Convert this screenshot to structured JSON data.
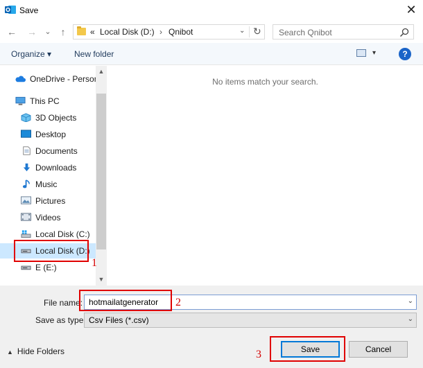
{
  "window": {
    "title": "Save",
    "app_icon": "outlook-app-icon",
    "close_glyph": "✕"
  },
  "navigation": {
    "back_glyph": "←",
    "forward_glyph": "→",
    "recent_glyph": "⌄",
    "up_glyph": "↑"
  },
  "address": {
    "overflow": "«",
    "segments": [
      "Local Disk (D:)",
      "Qnibot"
    ],
    "separator": "›",
    "dropdown_glyph": "⌄",
    "refresh_glyph": "↻"
  },
  "search": {
    "placeholder": "Search Qnibot",
    "icon": "search-icon"
  },
  "toolbar": {
    "organize_label": "Organize",
    "organize_dd": "▾",
    "new_folder_label": "New folder",
    "view_dd": "▾",
    "help_label": "?"
  },
  "sidebar": {
    "items": [
      {
        "label": "OneDrive - Person",
        "icon": "onedrive-cloud-icon"
      },
      {
        "label": "This PC",
        "icon": "computer-icon"
      },
      {
        "label": "3D Objects",
        "icon": "3d-objects-icon"
      },
      {
        "label": "Desktop",
        "icon": "desktop-icon"
      },
      {
        "label": "Documents",
        "icon": "documents-icon"
      },
      {
        "label": "Downloads",
        "icon": "downloads-icon"
      },
      {
        "label": "Music",
        "icon": "music-icon"
      },
      {
        "label": "Pictures",
        "icon": "pictures-icon"
      },
      {
        "label": "Videos",
        "icon": "videos-icon"
      },
      {
        "label": "Local Disk (C:)",
        "icon": "windows-drive-icon"
      },
      {
        "label": "Local Disk (D:)",
        "icon": "drive-icon",
        "selected": true
      },
      {
        "label": "E (E:)",
        "icon": "drive-icon"
      }
    ],
    "scroll_up": "▲",
    "scroll_down": "▼"
  },
  "content": {
    "empty_message": "No items match your search."
  },
  "form": {
    "file_name_label": "File name:",
    "file_name_value": "hotmailatgenerator",
    "save_as_type_label": "Save as type:",
    "save_as_type_value": "Csv Files (*.csv)",
    "dropdown_glyph": "⌄",
    "hide_folders_label": "Hide Folders",
    "hide_folders_glyph": "▲",
    "save_label": "Save",
    "cancel_label": "Cancel"
  },
  "annotations": {
    "step1": "1",
    "step2": "2",
    "step3": "3",
    "color": "#e00000"
  }
}
